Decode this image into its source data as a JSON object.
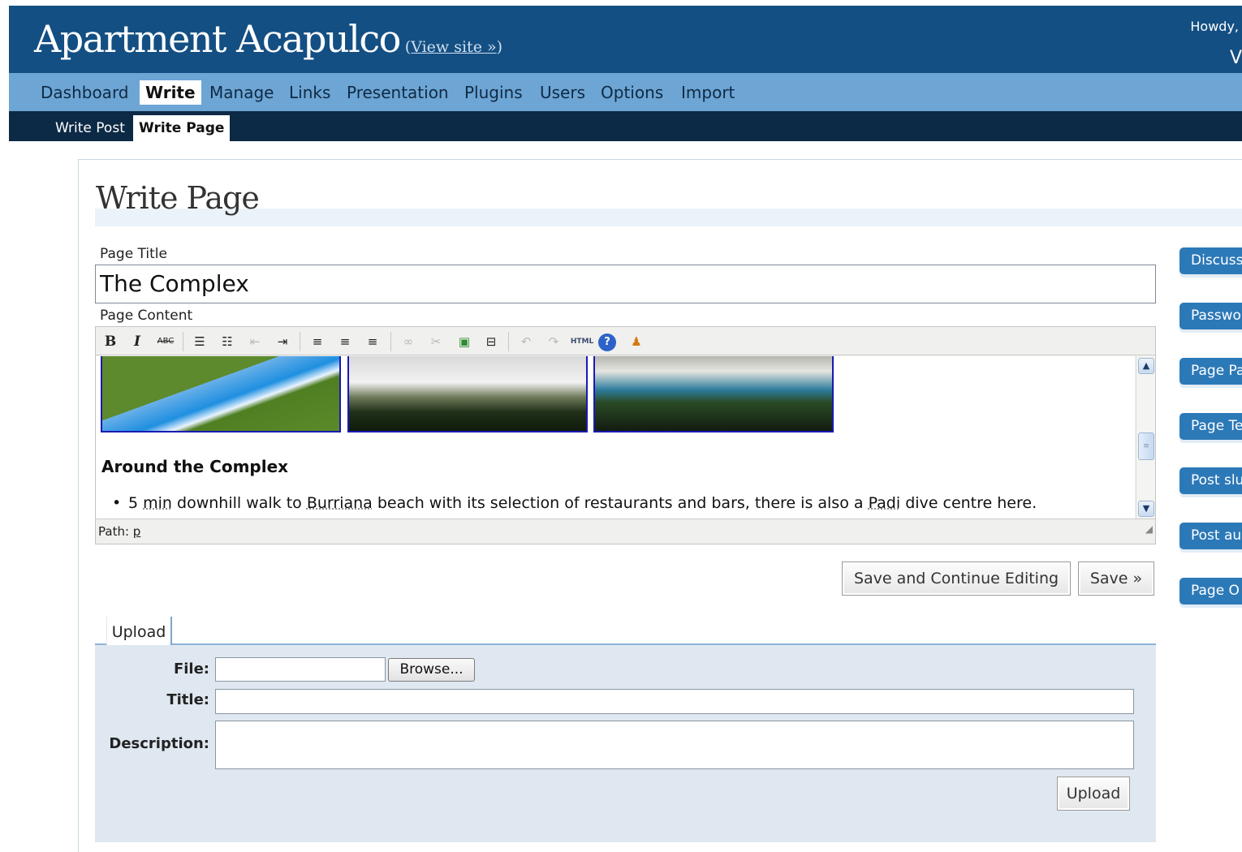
{
  "header": {
    "blog_title": "Apartment Acapulco",
    "view_site": "View site »",
    "howdy": "Howdy,",
    "howdy_cut": "V"
  },
  "main_menu": [
    "Dashboard",
    "Write",
    "Manage",
    "Links",
    "Presentation",
    "Plugins",
    "Users",
    "Options",
    "Import"
  ],
  "sub_menu": [
    "Write Post",
    "Write Page"
  ],
  "page": {
    "heading": "Write Page",
    "title_label": "Page Title",
    "title_value": "The Complex",
    "content_label": "Page Content"
  },
  "toolbar": {
    "icons": [
      "bold-icon",
      "italic-icon",
      "strikethrough-icon",
      "bullet-list-icon",
      "numbered-list-icon",
      "outdent-icon",
      "indent-icon",
      "align-left-icon",
      "align-center-icon",
      "align-right-icon",
      "link-icon",
      "unlink-icon",
      "image-icon",
      "more-icon",
      "undo-icon",
      "redo-icon",
      "html-icon",
      "help-icon",
      "user-icon"
    ],
    "html_label": "HTML"
  },
  "editor": {
    "heading": "Around the Complex",
    "bullet_pre": "5 ",
    "bullet_u1": "min",
    "bullet_mid": " downhill walk to ",
    "bullet_u2": "Burriana",
    "bullet_mid2": " beach with its selection of restaurants and bars, there is also a ",
    "bullet_u3": "Padi",
    "bullet_post": " dive centre here.",
    "path_label": "Path:",
    "path_value": "p"
  },
  "buttons": {
    "save_continue": "Save and Continue Editing",
    "save": "Save »"
  },
  "upload": {
    "tab": "Upload",
    "file_label": "File:",
    "browse": "Browse...",
    "title_label": "Title:",
    "description_label": "Description:",
    "upload_button": "Upload"
  },
  "side_tabs": [
    "Discuss",
    "Passwo",
    "Page Pa",
    "Page Te",
    "Post slu",
    "Post au",
    "Page O"
  ],
  "colors": {
    "header_bg": "#144f83",
    "menu_bg": "#6da5d4",
    "submenu_bg": "#0c2945",
    "side_tab_bg": "#2c79b8",
    "upload_panel_bg": "#dfe8f0"
  }
}
